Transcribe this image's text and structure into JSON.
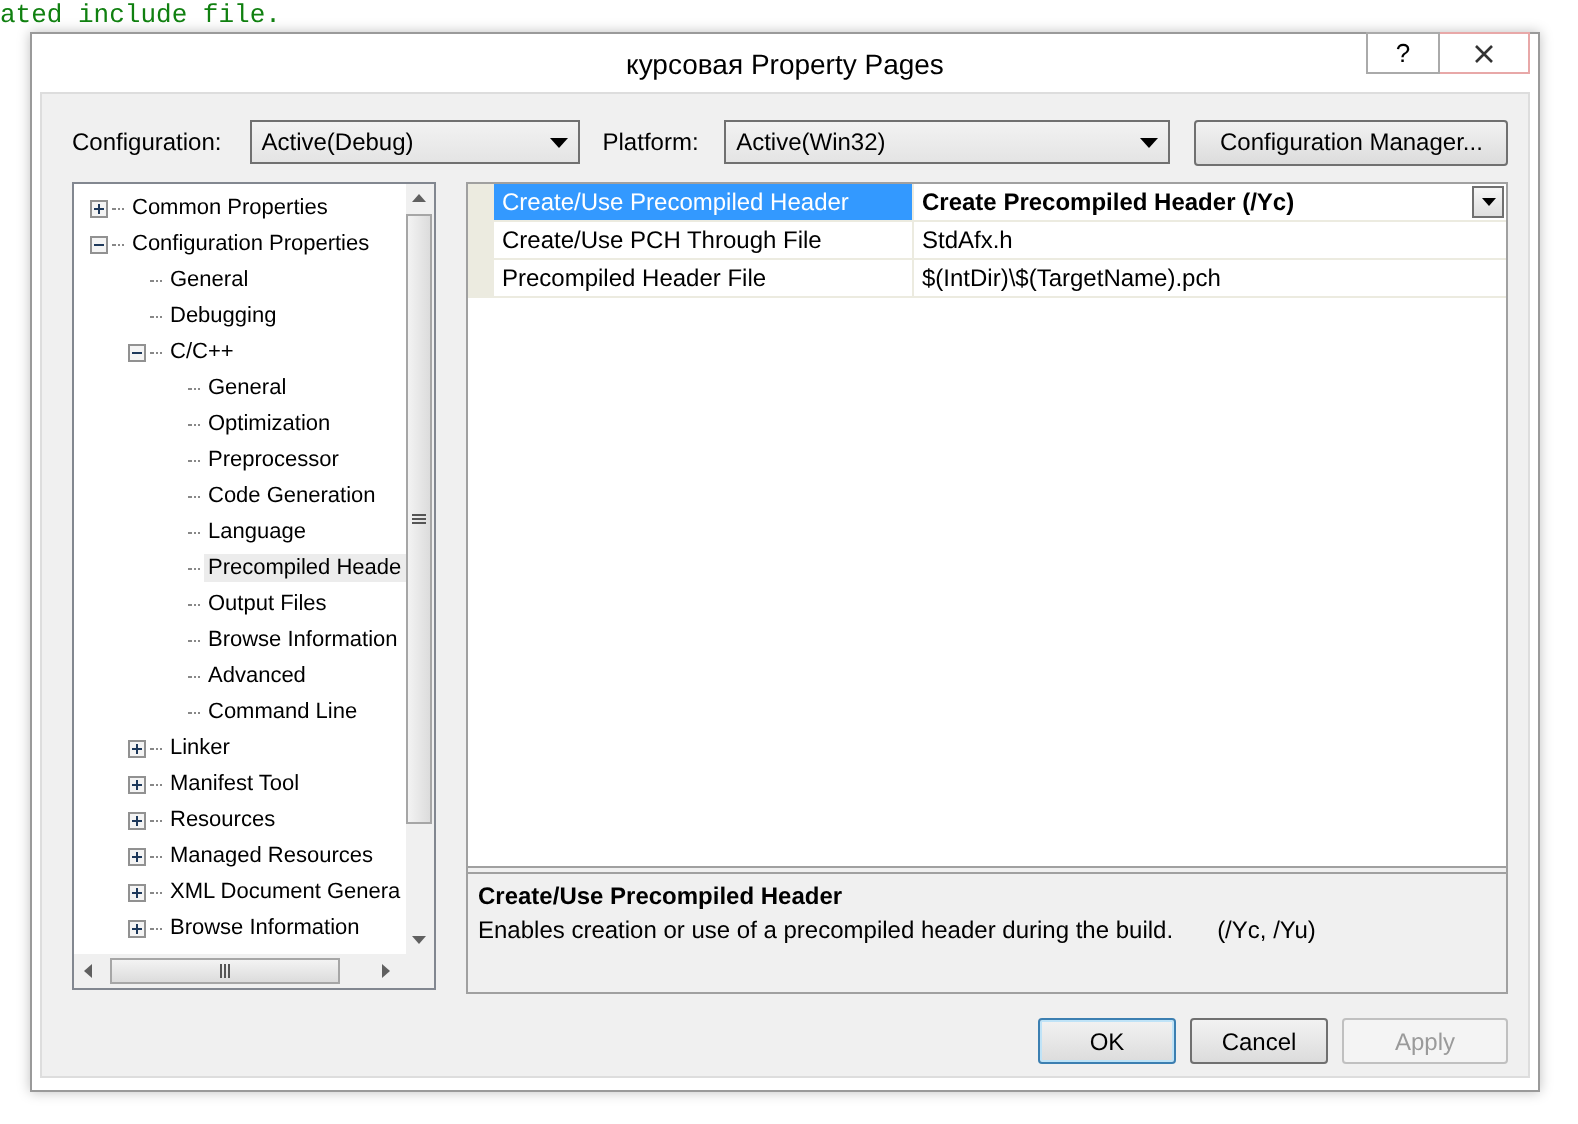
{
  "background_code": {
    "text": "ated include file."
  },
  "window": {
    "title": "курсовая Property Pages",
    "help_button": "?"
  },
  "configuration": {
    "label": "Configuration:",
    "value": "Active(Debug)"
  },
  "platform": {
    "label": "Platform:",
    "value": "Active(Win32)"
  },
  "configuration_manager_button": "Configuration Manager...",
  "tree": {
    "items": [
      {
        "label": "Common Properties",
        "kind": "folder",
        "expanded": false,
        "selected": false
      },
      {
        "label": "Configuration Properties",
        "kind": "folder",
        "expanded": true,
        "selected": false,
        "children": [
          {
            "label": "General",
            "kind": "leaf",
            "selected": false
          },
          {
            "label": "Debugging",
            "kind": "leaf",
            "selected": false
          },
          {
            "label": "C/C++",
            "kind": "folder",
            "expanded": true,
            "selected": false,
            "children": [
              {
                "label": "General",
                "kind": "leaf",
                "selected": false
              },
              {
                "label": "Optimization",
                "kind": "leaf",
                "selected": false
              },
              {
                "label": "Preprocessor",
                "kind": "leaf",
                "selected": false
              },
              {
                "label": "Code Generation",
                "kind": "leaf",
                "selected": false
              },
              {
                "label": "Language",
                "kind": "leaf",
                "selected": false
              },
              {
                "label": "Precompiled Heade",
                "kind": "leaf",
                "selected": true
              },
              {
                "label": "Output Files",
                "kind": "leaf",
                "selected": false
              },
              {
                "label": "Browse Information",
                "kind": "leaf",
                "selected": false
              },
              {
                "label": "Advanced",
                "kind": "leaf",
                "selected": false
              },
              {
                "label": "Command Line",
                "kind": "leaf",
                "selected": false
              }
            ]
          },
          {
            "label": "Linker",
            "kind": "folder",
            "expanded": false,
            "selected": false
          },
          {
            "label": "Manifest Tool",
            "kind": "folder",
            "expanded": false,
            "selected": false
          },
          {
            "label": "Resources",
            "kind": "folder",
            "expanded": false,
            "selected": false
          },
          {
            "label": "Managed Resources",
            "kind": "folder",
            "expanded": false,
            "selected": false
          },
          {
            "label": "XML Document Genera",
            "kind": "folder",
            "expanded": false,
            "selected": false
          },
          {
            "label": "Browse Information",
            "kind": "folder",
            "expanded": false,
            "selected": false
          }
        ]
      }
    ]
  },
  "properties": {
    "rows": [
      {
        "name": "Create/Use Precompiled Header",
        "value": "Create Precompiled Header (/Yc)",
        "selected": true,
        "modified": true
      },
      {
        "name": "Create/Use PCH Through File",
        "value": "StdAfx.h",
        "selected": false,
        "modified": false
      },
      {
        "name": "Precompiled Header File",
        "value": "$(IntDir)\\$(TargetName).pch",
        "selected": false,
        "modified": false
      }
    ]
  },
  "description": {
    "title": "Create/Use Precompiled Header",
    "text": "Enables creation or use of a precompiled header during the build.",
    "switches": "(/Yc, /Yu)"
  },
  "buttons": [
    {
      "label": "OK",
      "default": true,
      "disabled": false
    },
    {
      "label": "Cancel",
      "default": false,
      "disabled": false
    },
    {
      "label": "Apply",
      "default": false,
      "disabled": true
    }
  ]
}
